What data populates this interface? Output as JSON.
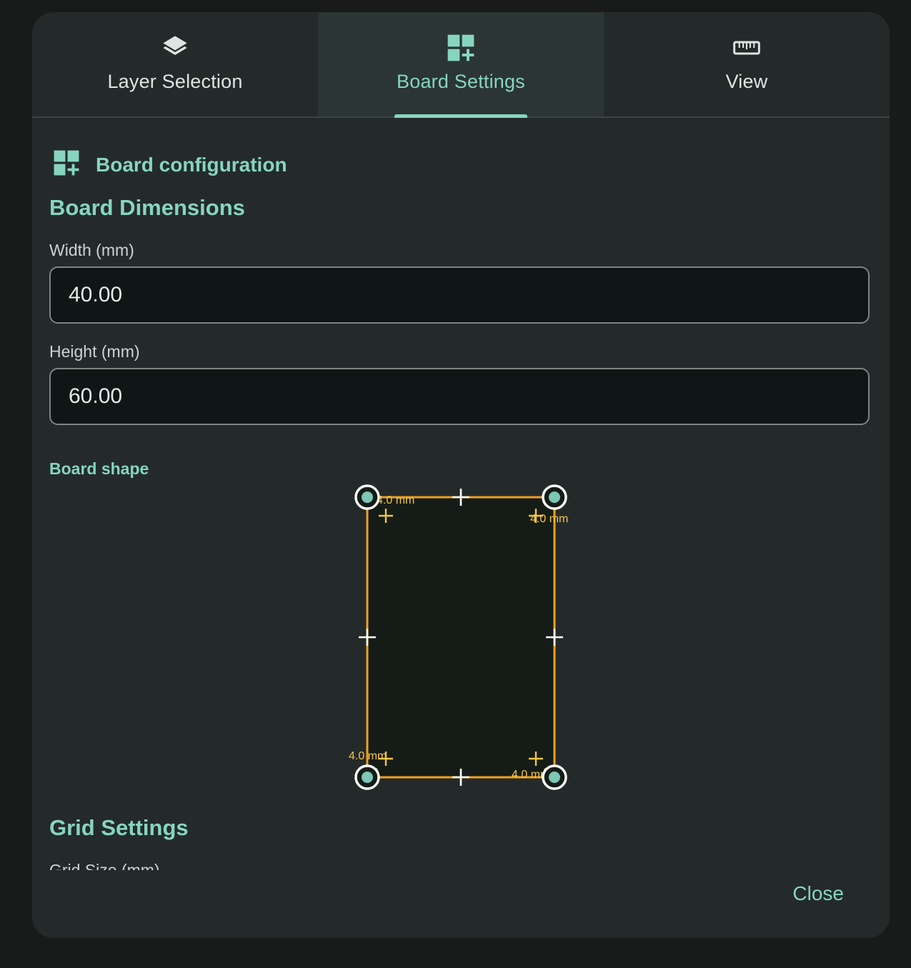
{
  "tabs": [
    {
      "label": "Layer Selection",
      "icon": "layers-icon",
      "active": false
    },
    {
      "label": "Board Settings",
      "icon": "dashboard-add-icon",
      "active": true
    },
    {
      "label": "View",
      "icon": "ruler-icon",
      "active": false
    }
  ],
  "section": {
    "title": "Board configuration",
    "icon": "dashboard-add-icon"
  },
  "dimensions": {
    "heading": "Board Dimensions",
    "width_label": "Width (mm)",
    "width_value": "40.00",
    "height_label": "Height (mm)",
    "height_value": "60.00"
  },
  "shape": {
    "label": "Board shape",
    "corner_radius_labels": {
      "top_left": "4.0 mm",
      "top_right": "4.0 mm",
      "bottom_left": "4.0 mm",
      "bottom_right": "4.0 mm"
    }
  },
  "grid": {
    "heading": "Grid Settings",
    "size_label": "Grid Size (mm)"
  },
  "footer": {
    "close_label": "Close"
  },
  "colors": {
    "accent": "#86d5c1",
    "board_outline": "#f0a020",
    "radius_marker": "#f5c542",
    "handle": "#ffffff",
    "board_fill": "#151c17"
  }
}
